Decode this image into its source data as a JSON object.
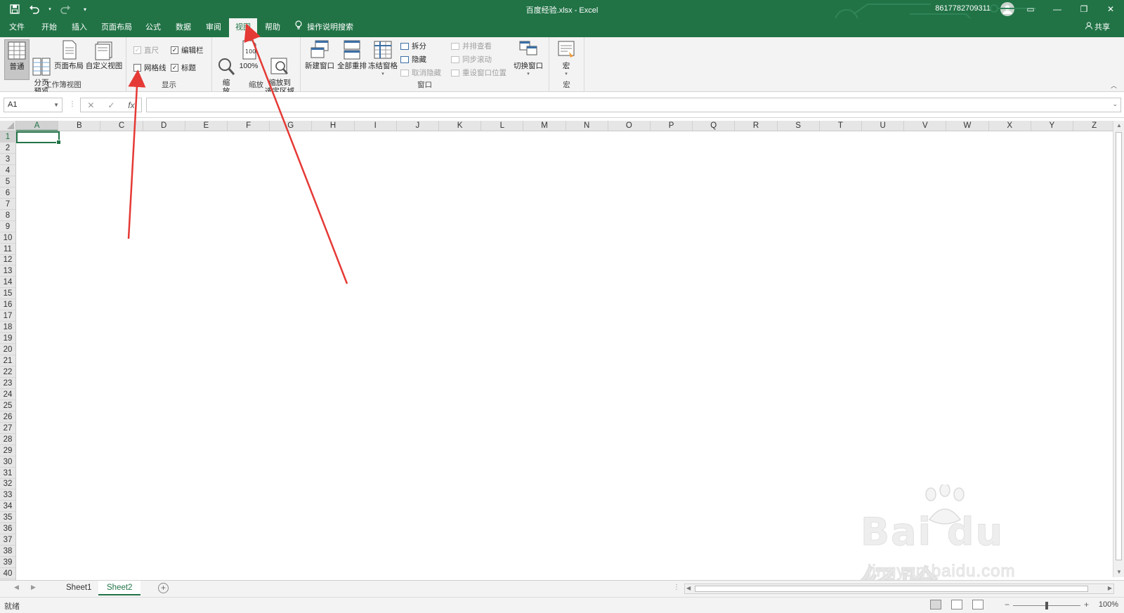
{
  "titlebar": {
    "title": "百度经验.xlsx  -  Excel",
    "account": "8617782709311",
    "qat_save": "save-icon",
    "qat_undo": "undo-icon",
    "qat_redo": "redo-icon"
  },
  "tabs": [
    "文件",
    "开始",
    "插入",
    "页面布局",
    "公式",
    "数据",
    "审阅",
    "视图",
    "帮助"
  ],
  "active_tab": "视图",
  "tell_me": "操作说明搜索",
  "share": "共享",
  "ribbon": {
    "workbook_views": {
      "label": "工作簿视图",
      "normal": "普通",
      "page_break": "分页\n预览",
      "page_layout": "页面布局",
      "custom_views": "自定义视图"
    },
    "show": {
      "label": "显示",
      "ruler": "直尺",
      "formula_bar": "编辑栏",
      "gridlines": "网格线",
      "headings": "标题",
      "ruler_checked": true,
      "formula_bar_checked": true,
      "gridlines_checked": false,
      "headings_checked": true
    },
    "zoom": {
      "label": "缩放",
      "zoom": "缩\n放",
      "hundred": "100%",
      "zoom_selection": "缩放到\n选定区域"
    },
    "window": {
      "label": "窗口",
      "new_window": "新建窗口",
      "arrange_all": "全部重排",
      "freeze_panes": "冻结窗格",
      "split": "拆分",
      "hide": "隐藏",
      "unhide": "取消隐藏",
      "view_side": "并排查看",
      "sync_scroll": "同步滚动",
      "reset_position": "重设窗口位置",
      "switch_windows": "切换窗口"
    },
    "macros": {
      "label": "宏",
      "macros": "宏"
    }
  },
  "formula_bar": {
    "name_box": "A1",
    "cancel": "✕",
    "enter": "✓",
    "fx": "fx",
    "value": ""
  },
  "columns": [
    "A",
    "B",
    "C",
    "D",
    "E",
    "F",
    "G",
    "H",
    "I",
    "J",
    "K",
    "L",
    "M",
    "N",
    "O",
    "P",
    "Q",
    "R",
    "S",
    "T",
    "U",
    "V",
    "W",
    "X",
    "Y",
    "Z"
  ],
  "rows": [
    "1",
    "2",
    "3",
    "4",
    "5",
    "6",
    "7",
    "8",
    "9",
    "10",
    "11",
    "12",
    "13",
    "14",
    "15",
    "16",
    "17",
    "18",
    "19",
    "20",
    "21",
    "22",
    "23",
    "24",
    "25",
    "26",
    "27",
    "28",
    "29",
    "30",
    "31",
    "32",
    "33",
    "34",
    "35",
    "36",
    "37",
    "38",
    "39",
    "40"
  ],
  "active_cell": "A1",
  "sheets": [
    "Sheet1",
    "Sheet2"
  ],
  "active_sheet": "Sheet2",
  "status": {
    "text": "就绪",
    "zoom": "100%"
  },
  "watermark": {
    "main": "Bai du 经验",
    "sub": "jingyan.baidu.com"
  },
  "colors": {
    "excel_green": "#217346",
    "arrow_red": "#e53935"
  }
}
